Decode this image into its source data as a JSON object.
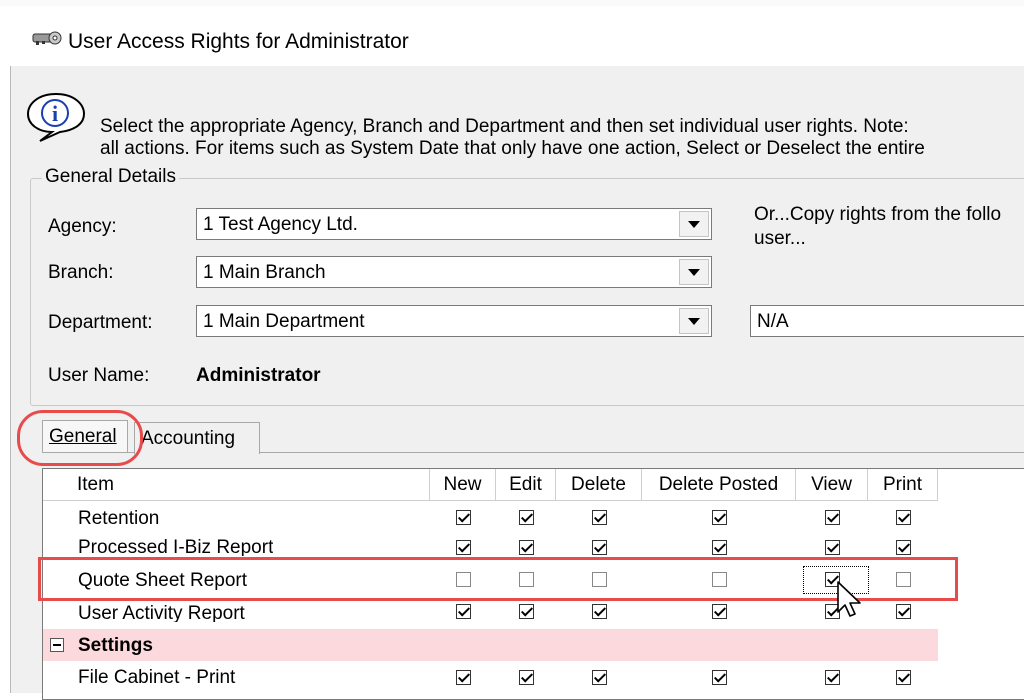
{
  "window": {
    "title": "User Access Rights for Administrator"
  },
  "info": {
    "line1": "Select the appropriate Agency, Branch and Department and then set individual user rights.  Note:",
    "line2": "all actions.  For items such as System Date that only have one action, Select or Deselect the entire"
  },
  "general_details": {
    "legend": "General Details",
    "agency_label": "Agency:",
    "agency_value": "1 Test Agency Ltd.",
    "branch_label": "Branch:",
    "branch_value": "1 Main Branch",
    "department_label": "Department:",
    "department_value": "1 Main Department",
    "username_label": "User Name:",
    "username_value": "Administrator",
    "copy_text_1": "Or...Copy rights from the follo",
    "copy_text_2": "user...",
    "copy_value": "N/A"
  },
  "tabs": [
    {
      "label": "General",
      "active": true
    },
    {
      "label": "Accounting",
      "active": false
    }
  ],
  "grid": {
    "columns": [
      "Item",
      "New",
      "Edit",
      "Delete",
      "Delete Posted",
      "View",
      "Print"
    ],
    "rows": [
      {
        "label": "Retention",
        "checks": [
          true,
          true,
          true,
          true,
          true,
          true
        ]
      },
      {
        "label": "Processed I-Biz Report",
        "checks": [
          true,
          true,
          true,
          true,
          true,
          true
        ]
      },
      {
        "label": "Quote Sheet Report",
        "checks": [
          false,
          false,
          false,
          false,
          true,
          false
        ]
      },
      {
        "label": "User Activity Report",
        "checks": [
          true,
          true,
          true,
          true,
          true,
          true
        ]
      },
      {
        "section": true,
        "label": "Settings"
      },
      {
        "label": "File Cabinet - Print",
        "checks": [
          true,
          true,
          true,
          true,
          true,
          true
        ]
      }
    ]
  },
  "colors": {
    "highlight": "#e84b4b",
    "section_bg": "#fcd9dc",
    "client_bg": "#f0f0f0"
  },
  "icons": {
    "title": "keys-icon",
    "info": "info-icon",
    "cursor": "mouse-pointer-icon"
  }
}
